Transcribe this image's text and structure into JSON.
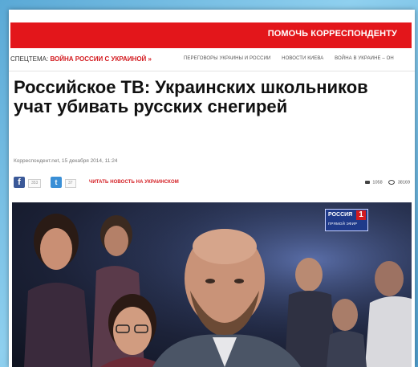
{
  "header": {
    "help_link": "ПОМОЧЬ КОРРЕСПОНДЕНТУ",
    "accent_color": "#e3161b"
  },
  "subnav": {
    "special_label": "СПЕЦТЕМА:",
    "special_topic": "ВОЙНА РОССИИ С УКРАИНОЙ »",
    "links": [
      "ПЕРЕГОВОРЫ УКРАИНЫ И РОССИИ",
      "НОВОСТИ КИЕВА",
      "ВОЙНА В УКРАИНЕ – ОН"
    ]
  },
  "article": {
    "title": "Российское ТВ: Украинских школьников учат убивать русских снегирей",
    "meta": "Корреспондент.net, 15 декабря 2014, 11:24",
    "facebook_count": "353",
    "twitter_count": "37",
    "read_ukrainian": "ЧИТАТЬ НОВОСТЬ НА УКРАИНСКОМ",
    "comments_count": "1058",
    "views_count": "38169"
  },
  "photo": {
    "channel_name": "РОССИЯ",
    "channel_number": "1",
    "channel_caption": "ПРЯМОЙ ЭФИР"
  }
}
